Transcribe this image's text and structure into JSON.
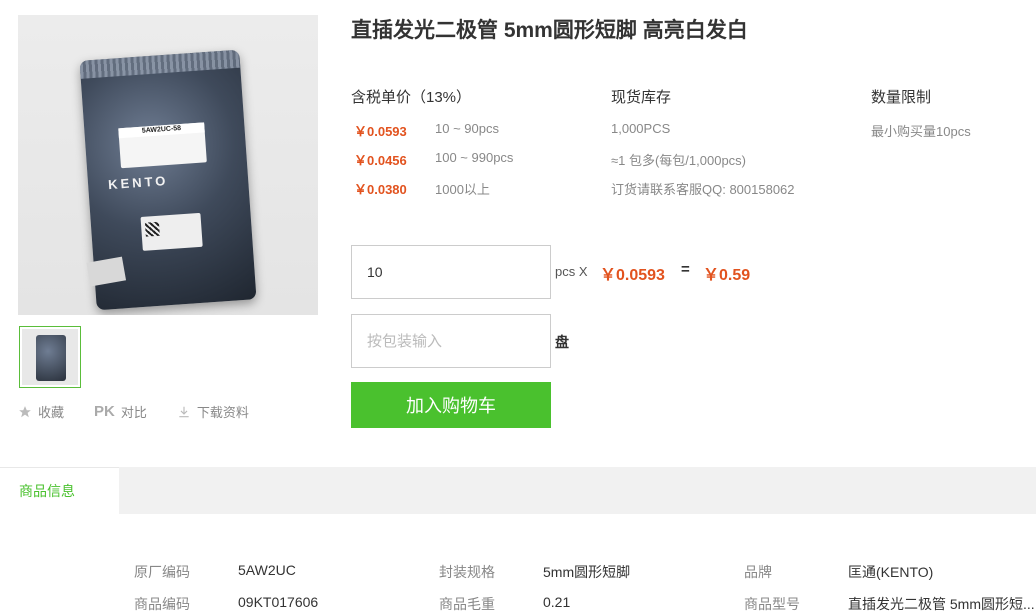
{
  "product": {
    "title": "直插发光二极管 5mm圆形短脚 高亮白发白",
    "image_label": "5AW2UC-58",
    "image_brand": "KENTO"
  },
  "actions": {
    "favorite": "收藏",
    "compare_badge": "PK",
    "compare": "对比",
    "download": "下载资料"
  },
  "pricing": {
    "header": "含税单价（13%）",
    "tiers": [
      {
        "price": "￥0.0593",
        "range": "10 ~ 90pcs"
      },
      {
        "price": "￥0.0456",
        "range": "100 ~ 990pcs"
      },
      {
        "price": "￥0.0380",
        "range": "1000以上"
      }
    ]
  },
  "stock": {
    "header": "现货库存",
    "qty": "1,000PCS",
    "pack": "≈1 包多(每包/1,000pcs)",
    "contact": "订货请联系客服QQ: 800158062"
  },
  "limit": {
    "header": "数量限制",
    "min": "最小购买量10pcs"
  },
  "order": {
    "qty_value": "10",
    "unit": "pcs X",
    "unit_price": "￥0.0593",
    "equals": "=",
    "total": "￥0.59",
    "pkg_placeholder": "按包装输入",
    "pkg_unit": "盘",
    "cart_button": "加入购物车"
  },
  "tabs": {
    "active": "商品信息"
  },
  "specs": [
    {
      "key": "原厂编码",
      "value": "5AW2UC"
    },
    {
      "key": "封装规格",
      "value": "5mm圆形短脚"
    },
    {
      "key": "品牌",
      "value": "匡通(KENTO)"
    },
    {
      "key": "商品编码",
      "value": "09KT017606"
    },
    {
      "key": "商品毛重",
      "value": "0.21"
    },
    {
      "key": "商品型号",
      "value": "直插发光二极管 5mm圆形短..."
    }
  ],
  "colors": {
    "accent_green": "#4ac12e",
    "price_orange": "#e2531f"
  }
}
